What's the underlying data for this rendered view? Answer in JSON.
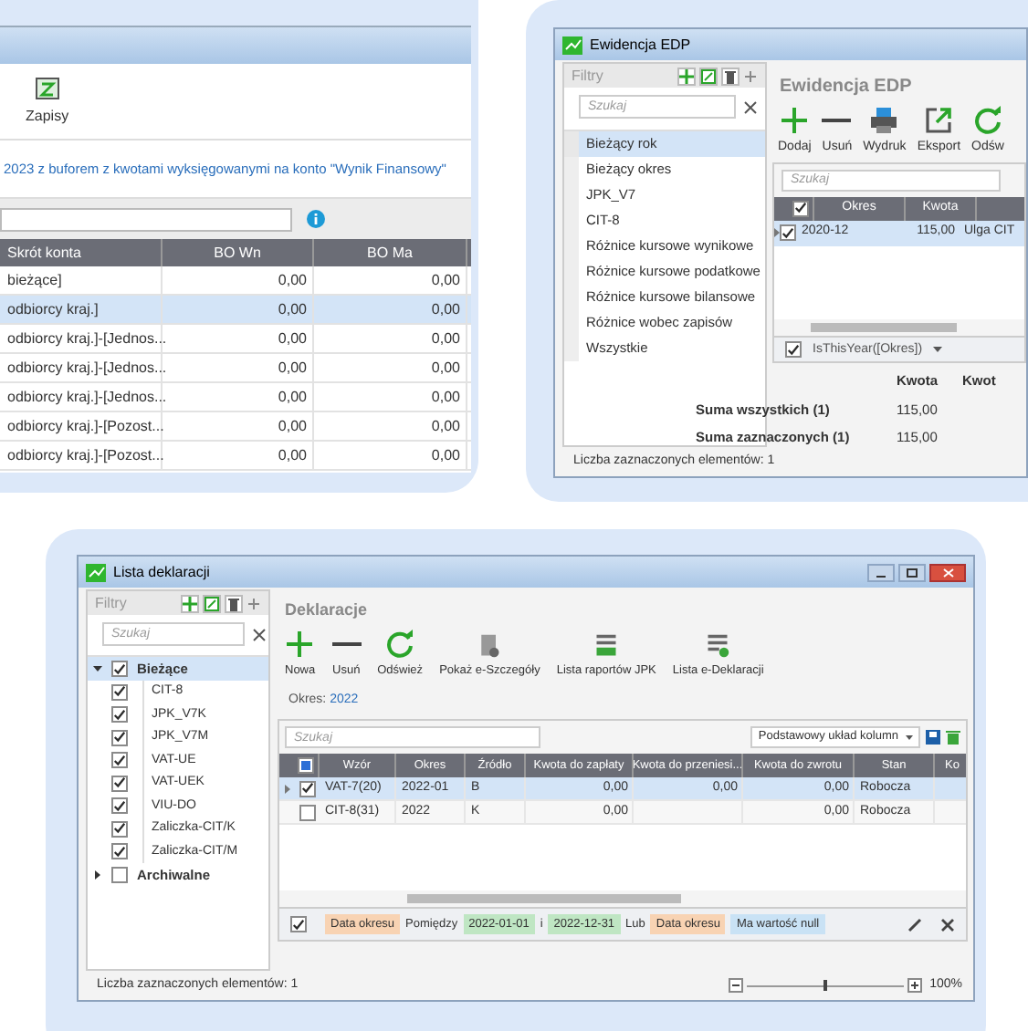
{
  "window_1": {
    "toolbar": [
      {
        "label": "Zapisy"
      }
    ],
    "info_text": "2023 z buforem z kwotami wyksięgowanymi na konto \"Wynik Finansowy\"",
    "table": {
      "columns": [
        "Skrót konta",
        "BO Wn",
        "BO Ma"
      ],
      "rows": [
        {
          "cells": [
            "bieżące]",
            "0,00",
            "0,00"
          ],
          "selected": false
        },
        {
          "cells": [
            "odbiorcy kraj.]",
            "0,00",
            "0,00"
          ],
          "selected": true
        },
        {
          "cells": [
            "odbiorcy kraj.]-[Jednos...",
            "0,00",
            "0,00"
          ],
          "selected": false
        },
        {
          "cells": [
            "odbiorcy kraj.]-[Jednos...",
            "0,00",
            "0,00"
          ],
          "selected": false
        },
        {
          "cells": [
            "odbiorcy kraj.]-[Jednos...",
            "0,00",
            "0,00"
          ],
          "selected": false
        },
        {
          "cells": [
            "odbiorcy kraj.]-[Pozost...",
            "0,00",
            "0,00"
          ],
          "selected": false
        },
        {
          "cells": [
            "odbiorcy kraj.]-[Pozost...",
            "0,00",
            "0,00"
          ],
          "selected": false
        }
      ]
    }
  },
  "window_2": {
    "title": "Ewidencja EDP",
    "filters": {
      "title": "Filtry",
      "search_placeholder": "Szukaj",
      "items": [
        {
          "label": "Bieżący rok",
          "selected": true
        },
        {
          "label": "Bieżący okres",
          "selected": false
        },
        {
          "label": "JPK_V7",
          "selected": false
        },
        {
          "label": "CIT-8",
          "selected": false
        },
        {
          "label": "Różnice kursowe wynikowe",
          "selected": false
        },
        {
          "label": "Różnice kursowe podatkowe",
          "selected": false
        },
        {
          "label": "Różnice kursowe bilansowe",
          "selected": false
        },
        {
          "label": "Różnice wobec zapisów",
          "selected": false
        },
        {
          "label": "Wszystkie",
          "selected": false
        }
      ]
    },
    "heading": "Ewidencja EDP",
    "toolbar": [
      {
        "kind": "add",
        "label": "Dodaj"
      },
      {
        "kind": "remove",
        "label": "Usuń"
      },
      {
        "kind": "print",
        "label": "Wydruk"
      },
      {
        "kind": "export",
        "label": "Eksport"
      },
      {
        "kind": "refresh",
        "label": "Odśw"
      }
    ],
    "grid": {
      "search_placeholder": "Szukaj",
      "header_checked": true,
      "columns": [
        "Okres",
        "Kwota"
      ],
      "rows": [
        {
          "cells": [
            "2020-12",
            "115,00",
            "Ulga CIT"
          ],
          "checked": true,
          "selected": true
        }
      ],
      "filter": {
        "checked": true,
        "expression": "IsThisYear([Okres])"
      }
    },
    "summary": {
      "columns": [
        "Kwota",
        "Kwot"
      ],
      "rows": [
        {
          "label": "Suma wszystkich (1)",
          "value": "115,00"
        },
        {
          "label": "Suma zaznaczonych (1)",
          "value": "115,00"
        }
      ]
    },
    "status": "Liczba zaznaczonych elementów: 1"
  },
  "window_3": {
    "title": "Lista deklaracji",
    "filters": {
      "title": "Filtry",
      "search_placeholder": "Szukaj",
      "tree": [
        {
          "label": "Bieżące",
          "checked": true,
          "expanded": true,
          "selected": true,
          "children": [
            {
              "label": "CIT-8",
              "checked": true
            },
            {
              "label": "JPK_V7K",
              "checked": true
            },
            {
              "label": "JPK_V7M",
              "checked": true
            },
            {
              "label": "VAT-UE",
              "checked": true
            },
            {
              "label": "VAT-UEK",
              "checked": true
            },
            {
              "label": "VIU-DO",
              "checked": true
            },
            {
              "label": "Zaliczka-CIT/K",
              "checked": true
            },
            {
              "label": "Zaliczka-CIT/M",
              "checked": true
            }
          ]
        },
        {
          "label": "Archiwalne",
          "checked": false,
          "expanded": false,
          "selected": false
        }
      ]
    },
    "heading": "Deklaracje",
    "toolbar": [
      {
        "kind": "add",
        "label": "Nowa"
      },
      {
        "kind": "remove",
        "label": "Usuń"
      },
      {
        "kind": "refresh",
        "label": "Odśwież"
      },
      {
        "kind": "details",
        "label": "Pokaż e-Szczegóły"
      },
      {
        "kind": "jpk",
        "label": "Lista raportów JPK"
      },
      {
        "kind": "edecl",
        "label": "Lista e-Deklaracji"
      }
    ],
    "period": {
      "label": "Okres:",
      "value": "2022"
    },
    "grid": {
      "search_placeholder": "Szukaj",
      "layout": "Podstawowy układ kolumn",
      "columns": [
        "Wzór",
        "Okres",
        "Źródło",
        "Kwota do zapłaty",
        "Kwota do przeniesi...",
        "Kwota do zwrotu",
        "Stan",
        "Ko"
      ],
      "rows": [
        {
          "cells": [
            "VAT-7(20)",
            "2022-01",
            "B",
            "0,00",
            "0,00",
            "0,00",
            "Robocza",
            ""
          ],
          "checked": true,
          "selected": true
        },
        {
          "cells": [
            "CIT-8(31)",
            "2022",
            "K",
            "0,00",
            "",
            "0,00",
            "Robocza",
            ""
          ],
          "checked": false,
          "selected": false
        }
      ],
      "filter": {
        "checked": true,
        "chips": [
          {
            "kind": "field",
            "text": "Data okresu"
          },
          {
            "kind": "operator",
            "text": "Pomiędzy"
          },
          {
            "kind": "value",
            "text": "2022-01-01"
          },
          {
            "kind": "operator",
            "text": "i"
          },
          {
            "kind": "value",
            "text": "2022-12-31"
          },
          {
            "kind": "operator",
            "text": "Lub"
          },
          {
            "kind": "field",
            "text": "Data okresu"
          },
          {
            "kind": "null",
            "text": "Ma wartość null"
          }
        ]
      }
    },
    "status": "Liczba zaznaczonych elementów: 1",
    "zoom": {
      "level": 0.5,
      "reading": "100%"
    }
  }
}
